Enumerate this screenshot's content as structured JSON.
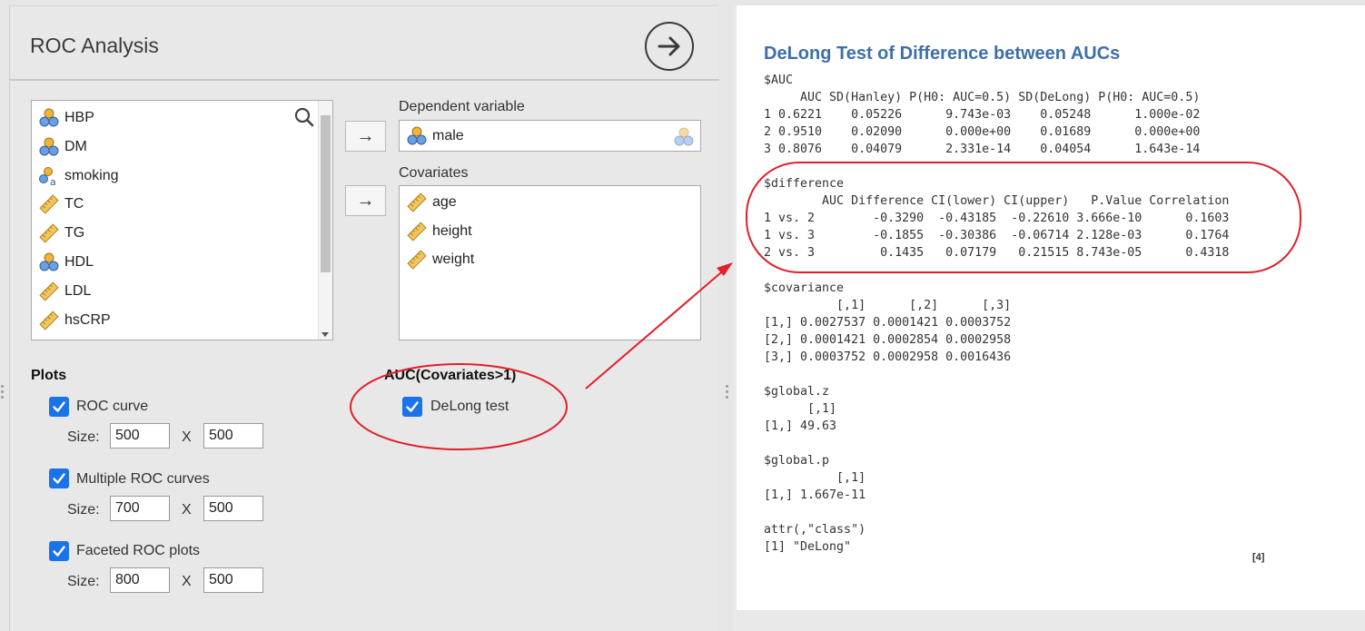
{
  "options_panel": {
    "title": "ROC Analysis",
    "variables": [
      {
        "name": "HBP",
        "type": "nominal"
      },
      {
        "name": "DM",
        "type": "nominal"
      },
      {
        "name": "smoking",
        "type": "nominal-text"
      },
      {
        "name": "TC",
        "type": "continuous"
      },
      {
        "name": "TG",
        "type": "continuous"
      },
      {
        "name": "HDL",
        "type": "nominal"
      },
      {
        "name": "LDL",
        "type": "continuous"
      },
      {
        "name": "hsCRP",
        "type": "continuous"
      }
    ],
    "dependent_label": "Dependent variable",
    "dependent_value": "male",
    "covariates_label": "Covariates",
    "covariates": [
      "age",
      "height",
      "weight"
    ],
    "arrow_glyph": "→",
    "plots": {
      "title": "Plots",
      "size_label": "Size:",
      "x_label": "X",
      "items": [
        {
          "label": "ROC curve",
          "checked": true,
          "width": "500",
          "height": "500"
        },
        {
          "label": "Multiple ROC curves",
          "checked": true,
          "width": "700",
          "height": "500"
        },
        {
          "label": "Faceted ROC plots",
          "checked": true,
          "width": "800",
          "height": "500"
        }
      ]
    },
    "auc": {
      "title": "AUC(Covariates>1)",
      "delong_label": "DeLong test",
      "delong_checked": true
    }
  },
  "results": {
    "title": "DeLong Test of Difference between AUCs",
    "output_text": "$AUC\n     AUC SD(Hanley) P(H0: AUC=0.5) SD(DeLong) P(H0: AUC=0.5)\n1 0.6221    0.05226      9.743e-03    0.05248      1.000e-02\n2 0.9510    0.02090      0.000e+00    0.01689      0.000e+00\n3 0.8076    0.04079      2.331e-14    0.04054      1.643e-14\n\n$difference\n        AUC Difference CI(lower) CI(upper)   P.Value Correlation\n1 vs. 2        -0.3290  -0.43185  -0.22610 3.666e-10      0.1603\n1 vs. 3        -0.1855  -0.30386  -0.06714 2.128e-03      0.1764\n2 vs. 3         0.1435   0.07179   0.21515 8.743e-05      0.4318\n\n$covariance\n          [,1]      [,2]      [,3]\n[1,] 0.0027537 0.0001421 0.0003752\n[2,] 0.0001421 0.0002854 0.0002958\n[3,] 0.0003752 0.0002958 0.0016436\n\n$global.z\n      [,1]\n[1,] 49.63\n\n$global.p\n          [,1]\n[1,] 1.667e-11\n\nattr(,\"class\")\n[1] \"DeLong\"",
    "page_ref": "[4]"
  },
  "colors": {
    "checkbox": "#1a73e8",
    "results_title": "#3e6fa8",
    "annotation": "#e0202a"
  }
}
